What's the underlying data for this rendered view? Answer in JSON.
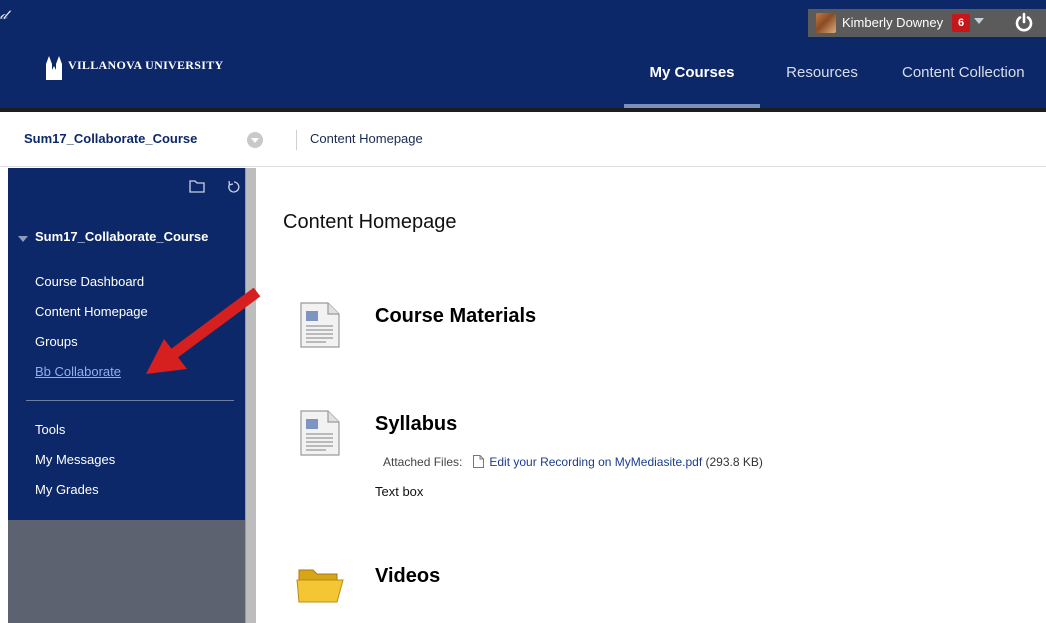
{
  "header": {
    "utility_glyph": "𝒹",
    "user": {
      "name": "Kimberly Downey",
      "notification_count": "6"
    },
    "brand": {
      "name": "VILLANOVA UNIVERSITY"
    },
    "nav": [
      {
        "label": "My Courses",
        "active": true
      },
      {
        "label": "Resources",
        "active": false
      },
      {
        "label": "Content Collection",
        "active": false
      }
    ]
  },
  "breadcrumb": {
    "course": "Sum17_Collaborate_Course",
    "page": "Content Homepage"
  },
  "course_menu": {
    "course_title": "Sum17_Collaborate_Course",
    "items": [
      {
        "label": "Course Dashboard"
      },
      {
        "label": "Content Homepage"
      },
      {
        "label": "Groups"
      },
      {
        "label": "Bb Collaborate"
      }
    ],
    "tools": [
      {
        "label": "Tools"
      },
      {
        "label": "My Messages"
      },
      {
        "label": "My Grades"
      }
    ]
  },
  "content": {
    "title": "Content Homepage",
    "items": [
      {
        "title": "Course Materials",
        "icon": "document-icon"
      },
      {
        "title": "Syllabus",
        "icon": "document-icon",
        "attached_label": "Attached Files:",
        "file_name": "Edit your Recording on MyMediasite.pdf",
        "file_size": "(293.8 KB)",
        "body": "Text box"
      },
      {
        "title": "Videos",
        "icon": "folder-icon"
      }
    ]
  },
  "colors": {
    "header_navy": "#0d2869",
    "menu_navy": "#0d2869",
    "notification_red": "#c5161a",
    "annotation_arrow": "#d62020",
    "link_blue": "#1a3d8f"
  }
}
